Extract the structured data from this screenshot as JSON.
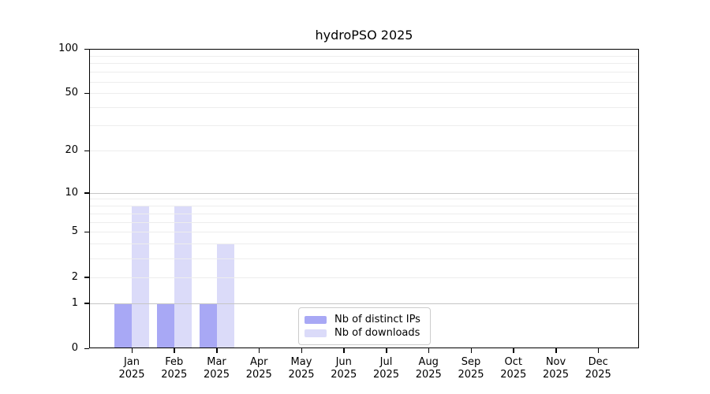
{
  "title": "hydroPSO 2025",
  "chart_data": {
    "type": "bar",
    "title": "hydroPSO 2025",
    "categories": [
      "Jan",
      "Feb",
      "Mar",
      "Apr",
      "May",
      "Jun",
      "Jul",
      "Aug",
      "Sep",
      "Oct",
      "Nov",
      "Dec"
    ],
    "x_year": "2025",
    "series": [
      {
        "name": "Nb of distinct IPs",
        "color": "#a8a8f5",
        "values": [
          1,
          1,
          1,
          0,
          0,
          0,
          0,
          0,
          0,
          0,
          0,
          0
        ]
      },
      {
        "name": "Nb of downloads",
        "color": "#dbdbf9",
        "values": [
          8,
          8,
          4,
          0,
          0,
          0,
          0,
          0,
          0,
          0,
          0,
          0
        ]
      }
    ],
    "y_axis": {
      "scale": "log1p",
      "min": 0,
      "max": 100,
      "ticks": [
        0,
        1,
        2,
        5,
        10,
        20,
        50,
        100
      ],
      "gridlines_minor": [
        2,
        3,
        4,
        5,
        6,
        7,
        8,
        9,
        20,
        30,
        40,
        50,
        60,
        70,
        80,
        90
      ],
      "gridlines_major": [
        1,
        10,
        100
      ]
    },
    "xlabel": "",
    "ylabel": "",
    "grid": true,
    "legend_position": "inside-bottom-center",
    "colors": {
      "grid_minor": "#ededed",
      "grid_major": "#c6c6c6",
      "axis": "#000000",
      "legend_border": "#cccccc",
      "background": "#ffffff"
    }
  }
}
